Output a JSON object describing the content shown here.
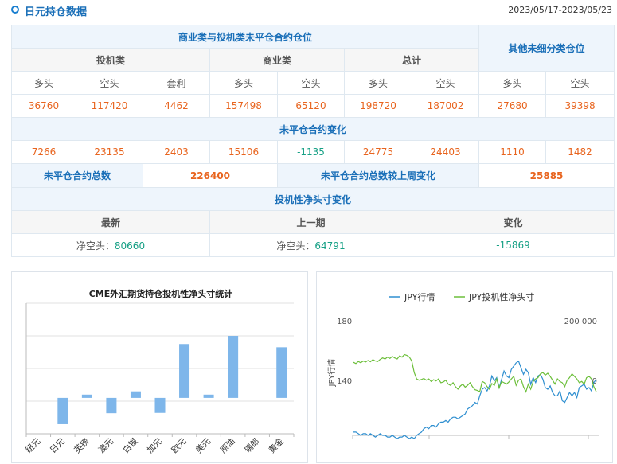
{
  "header": {
    "title": "日元持仓数据",
    "date_range": "2023/05/17-2023/05/23"
  },
  "table": {
    "main_title": "商业类与投机类未平仓合约仓位",
    "other_title": "其他未细分类仓位",
    "groups": [
      "投机类",
      "商业类",
      "总计"
    ],
    "sub_headers": [
      "多头",
      "空头",
      "套利",
      "多头",
      "空头",
      "多头",
      "空头",
      "多头",
      "空头"
    ],
    "positions": [
      "36760",
      "117420",
      "4462",
      "157498",
      "65120",
      "198720",
      "187002",
      "27680",
      "39398"
    ],
    "change_title": "未平仓合约变化",
    "changes": [
      "7266",
      "23135",
      "2403",
      "15106",
      "-1135",
      "24775",
      "24403",
      "1110",
      "1482"
    ],
    "oi_total_label": "未平仓合约总数",
    "oi_total_value": "226400",
    "oi_change_label": "未平仓合约总数较上周变化",
    "oi_change_value": "25885",
    "net_title": "投机性净头寸变化",
    "net_headers": [
      "最新",
      "上一期",
      "变化"
    ],
    "net_latest": {
      "label": "净空头：",
      "value": "80660"
    },
    "net_prev": {
      "label": "净空头：",
      "value": "64791"
    },
    "net_change": "-15869"
  },
  "colors": {
    "accent": "#1a6fb8",
    "orange": "#e8641e",
    "green": "#16a085",
    "bar": "#7eb6ea",
    "jpy_line": "#2f8fd0",
    "net_line": "#6cbf3a"
  },
  "chart_data": [
    {
      "type": "bar",
      "title": "CME外汇期货持仓投机性净头寸统计",
      "categories": [
        "纽元",
        "日元",
        "英镑",
        "澳元",
        "白银",
        "加元",
        "欧元",
        "美元",
        "原油",
        "瑞郎",
        "黄金"
      ],
      "values": [
        0,
        -80660,
        10000,
        -47000,
        20000,
        -46000,
        165000,
        10000,
        190000,
        0,
        155000
      ],
      "ylim": [
        -110000,
        290000
      ],
      "grid": true
    },
    {
      "type": "line",
      "legend": [
        "JPY行情",
        "JPY投机性净头寸"
      ],
      "legend_position": "top",
      "ylabel": "JPY行情",
      "left_ticks": [
        "180",
        "140"
      ],
      "right_ticks": [
        "200 000",
        "0"
      ],
      "left_range": [
        110,
        180
      ],
      "right_range": [
        -250000,
        200000
      ],
      "series": [
        {
          "name": "JPY行情",
          "axis": "left",
          "values": [
            112,
            112,
            111,
            110,
            111,
            111,
            110,
            111,
            110,
            109,
            110,
            111,
            110,
            110,
            109,
            109,
            110,
            109,
            108,
            109,
            109,
            110,
            109,
            108,
            109,
            108,
            110,
            111,
            112,
            114,
            115,
            114,
            116,
            116,
            115,
            117,
            118,
            118,
            119,
            118,
            120,
            121,
            121,
            120,
            121,
            122,
            123,
            126,
            127,
            128,
            130,
            129,
            134,
            138,
            139,
            137,
            140,
            146,
            143,
            145,
            139,
            144,
            149,
            146,
            145,
            150,
            152,
            154,
            155,
            151,
            147,
            150,
            148,
            141,
            145,
            142,
            146,
            147,
            144,
            139,
            138,
            140,
            136,
            134,
            134,
            137,
            131,
            130,
            133,
            136,
            134,
            136,
            133,
            139,
            140,
            141,
            138,
            139,
            137,
            142,
            144
          ]
        },
        {
          "name": "JPY投机性净头寸",
          "axis": "right",
          "values": [
            35000,
            30000,
            38000,
            33000,
            40000,
            36000,
            42000,
            37000,
            45000,
            40000,
            38000,
            46000,
            52000,
            48000,
            55000,
            50000,
            58000,
            52000,
            48000,
            60000,
            55000,
            65000,
            62000,
            55000,
            40000,
            -5000,
            -30000,
            -35000,
            -32000,
            -28000,
            -35000,
            -30000,
            -40000,
            -33000,
            -38000,
            -30000,
            -45000,
            -42000,
            -35000,
            -50000,
            -55000,
            -45000,
            -60000,
            -70000,
            -58000,
            -50000,
            -62000,
            -55000,
            -45000,
            -60000,
            -72000,
            -75000,
            -80000,
            -40000,
            -45000,
            -60000,
            -70000,
            -48000,
            -55000,
            -30000,
            -65000,
            -40000,
            -45000,
            -50000,
            -42000,
            -30000,
            -20000,
            -55000,
            -35000,
            -30000,
            -60000,
            -80000,
            -50000,
            -70000,
            -40000,
            -30000,
            -25000,
            -10000,
            -5000,
            -15000,
            -8000,
            -20000,
            -35000,
            -50000,
            -30000,
            -40000,
            -45000,
            -60000,
            -35000,
            -25000,
            -10000,
            -20000,
            -30000,
            -45000,
            -40000,
            -50000,
            -25000,
            -20000,
            -30000,
            -60000,
            -80660
          ]
        }
      ]
    }
  ]
}
